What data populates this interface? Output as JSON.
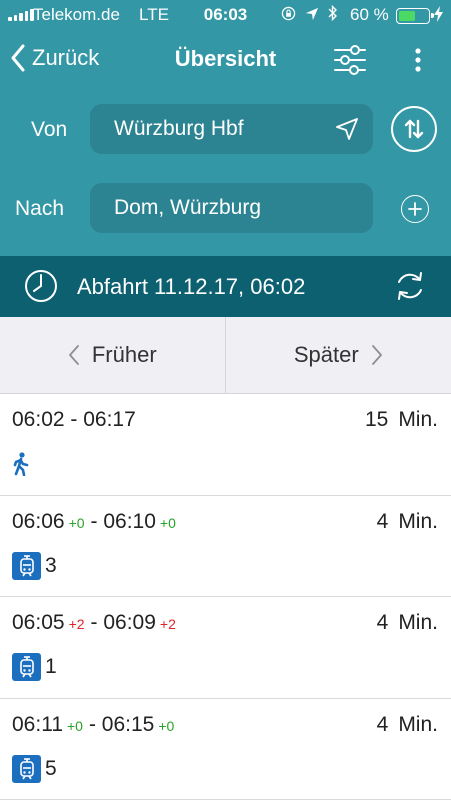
{
  "status_bar": {
    "carrier": "Telekom.de",
    "network": "LTE",
    "time": "06:03",
    "battery_percent": "60 %",
    "battery_level": 0.6,
    "icons": [
      "orientation-lock-icon",
      "location-arrow-icon",
      "bluetooth-icon"
    ]
  },
  "nav": {
    "back_label": "Zurück",
    "title": "Übersicht"
  },
  "route": {
    "from_label": "Von",
    "from_value": "Würzburg Hbf",
    "to_label": "Nach",
    "to_value": "Dom, Würzburg"
  },
  "time_bar": {
    "text": "Abfahrt 11.12.17, 06:02"
  },
  "paging": {
    "earlier": "Früher",
    "later": "Später"
  },
  "connections": [
    {
      "departure": "06:02",
      "dep_delay": "",
      "arrival": "06:17",
      "arr_delay": "",
      "duration": "15",
      "unit": "Min.",
      "mode": "walk-icon",
      "line": ""
    },
    {
      "departure": "06:06",
      "dep_delay": "+0",
      "arrival": "06:10",
      "arr_delay": "+0",
      "duration": "4",
      "unit": "Min.",
      "mode": "tram-icon",
      "line": "3"
    },
    {
      "departure": "06:05",
      "dep_delay": "+2",
      "arrival": "06:09",
      "arr_delay": "+2",
      "duration": "4",
      "unit": "Min.",
      "mode": "tram-icon",
      "line": "1"
    },
    {
      "departure": "06:11",
      "dep_delay": "+0",
      "arrival": "06:15",
      "arr_delay": "+0",
      "duration": "4",
      "unit": "Min.",
      "mode": "tram-icon",
      "line": "5"
    }
  ],
  "colors": {
    "header": "#3397a5",
    "field": "#2c8391",
    "time_bar": "#0d6070",
    "on_time": "#2aa12a",
    "delayed": "#e0242a",
    "tram_badge": "#1c6fbe"
  }
}
